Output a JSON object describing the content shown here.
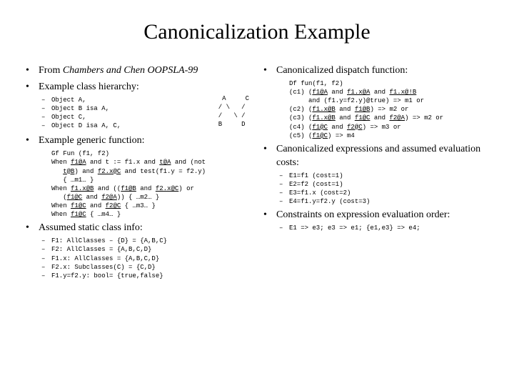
{
  "title": "Canonicalization Example",
  "left": {
    "b1a": "From ",
    "b1b": "Chambers and Chen OOPSLA-99",
    "b2": "Example class hierarchy:",
    "hierarchy": [
      "Object A,",
      "Object B isa A,",
      "Object C,",
      "Object D isa A, C,"
    ],
    "hierarchy_ascii": " A     C\n/ \\   /\n/   \\ /\nB     D",
    "b3": "Example generic function:",
    "gf": "Gf Fun (f1, f2)\nWhen f1@A and t := f1.x and t@A and (not\n   t@B) and f2.x@C and test(f1.y = f2.y)\n   { …m1… }\nWhen f1.x@B and ((f1@B and f2.x@C) or\n   (f1@C and f2@A)) { …m2… }\nWhen f1@C and f2@C { …m3… }\nWhen f1@C { …m4… }",
    "gf_u": [
      "f1@A",
      "t@A",
      "t@B",
      "f2.x@C",
      "f1.x@B",
      "f1@B",
      "f2.x@C",
      "f1@C",
      "f2@A",
      "f1@C",
      "f2@C",
      "f1@C"
    ],
    "b4": "Assumed static class info:",
    "static": [
      "F1: AllClasses – {D} = {A,B,C}",
      "F2: AllClasses = {A,B,C,D}",
      "F1.x: AllClasses = {A,B,C,D}",
      "F2.x: Subclasses(C) = {C,D}",
      "F1.y=f2.y: bool= {true,false}"
    ]
  },
  "right": {
    "b1": "Canonicalized dispatch function:",
    "df": "Df fun(f1, f2)\n(c1) (f1@A and f1.x@A and f1.x@!B\n     and (f1.y=f2.y)@true) => m1 or\n(c2) (f1.x@B and f1@B) => m2 or\n(c3) (f1.x@B and f1@C and f2@A) => m2 or\n(c4) (f1@C and f2@C) => m3 or\n(c5) (f1@C) => m4",
    "df_u": [
      "f1@A",
      "f1.x@A",
      "f1.x@!B",
      "f1.x@B",
      "f1@B",
      "f1.x@B",
      "f1@C",
      "f2@A",
      "f1@C",
      "f2@C",
      "f1@C"
    ],
    "b2": "Canonicalized expressions and assumed evaluation costs:",
    "costs": [
      "E1=f1 (cost=1)",
      "E2=f2 (cost=1)",
      "E3=f1.x (cost=2)",
      "E4=f1.y=f2.y (cost=3)"
    ],
    "b3": "Constraints on expression evaluation order:",
    "order": [
      "E1 => e3; e3 => e1; {e1,e3} => e4;"
    ]
  }
}
